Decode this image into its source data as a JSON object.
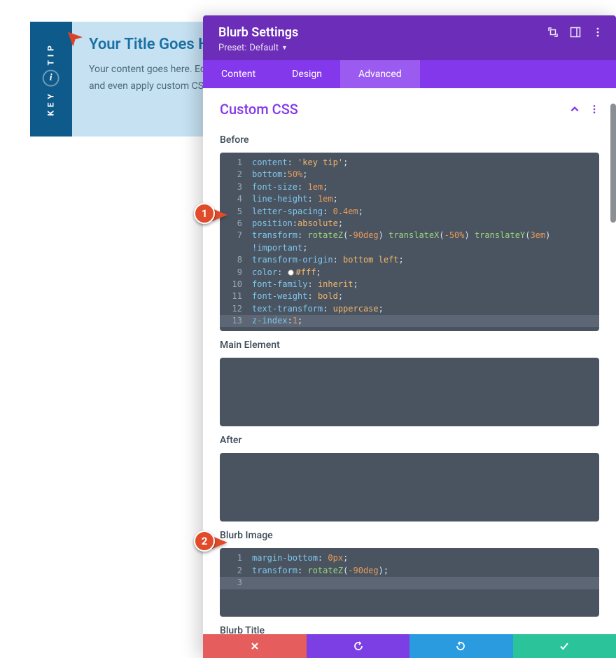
{
  "preview": {
    "side_label": "KEY TIP",
    "title": "Your Title Goes H",
    "body": "Your content goes here. Edit settings. You can also style e and even apply custom CSS t"
  },
  "panel": {
    "title": "Blurb Settings",
    "preset_prefix": "Preset: ",
    "preset_value": "Default"
  },
  "tabs": [
    {
      "id": "content",
      "label": "Content",
      "active": false
    },
    {
      "id": "design",
      "label": "Design",
      "active": false
    },
    {
      "id": "advanced",
      "label": "Advanced",
      "active": true
    }
  ],
  "section": {
    "title": "Custom CSS"
  },
  "fields": {
    "before": {
      "label": "Before"
    },
    "main_element": {
      "label": "Main Element"
    },
    "after": {
      "label": "After"
    },
    "blurb_image": {
      "label": "Blurb Image"
    },
    "blurb_title": {
      "label": "Blurb Title"
    }
  },
  "code": {
    "before": [
      {
        "n": 1,
        "parts": [
          [
            "prop",
            "content"
          ],
          [
            "punc",
            ": "
          ],
          [
            "str",
            "'key tip'"
          ],
          [
            "punc",
            ";"
          ]
        ]
      },
      {
        "n": 2,
        "parts": [
          [
            "prop",
            "bottom"
          ],
          [
            "punc",
            ":"
          ],
          [
            "num",
            "50%"
          ],
          [
            "punc",
            ";"
          ]
        ]
      },
      {
        "n": 3,
        "parts": [
          [
            "prop",
            "font-size"
          ],
          [
            "punc",
            ": "
          ],
          [
            "num",
            "1em"
          ],
          [
            "punc",
            ";"
          ]
        ]
      },
      {
        "n": 4,
        "parts": [
          [
            "prop",
            "line-height"
          ],
          [
            "punc",
            ": "
          ],
          [
            "num",
            "1em"
          ],
          [
            "punc",
            ";"
          ]
        ]
      },
      {
        "n": 5,
        "parts": [
          [
            "prop",
            "letter-spacing"
          ],
          [
            "punc",
            ": "
          ],
          [
            "num",
            "0.4em"
          ],
          [
            "punc",
            ";"
          ]
        ]
      },
      {
        "n": 6,
        "parts": [
          [
            "prop",
            "position"
          ],
          [
            "punc",
            ":"
          ],
          [
            "kw",
            "absolute"
          ],
          [
            "punc",
            ";"
          ]
        ]
      },
      {
        "n": 7,
        "parts": [
          [
            "prop",
            "transform"
          ],
          [
            "punc",
            ": "
          ],
          [
            "fn",
            "rotateZ"
          ],
          [
            "punc",
            "("
          ],
          [
            "num",
            "-90deg"
          ],
          [
            "punc",
            ") "
          ],
          [
            "fn",
            "translateX"
          ],
          [
            "punc",
            "("
          ],
          [
            "num",
            "-50%"
          ],
          [
            "punc",
            ") "
          ],
          [
            "fn",
            "translateY"
          ],
          [
            "punc",
            "("
          ],
          [
            "num",
            "3em"
          ],
          [
            "punc",
            ") "
          ],
          [
            "imp",
            "!important"
          ],
          [
            "punc",
            ";"
          ]
        ]
      },
      {
        "n": 8,
        "parts": [
          [
            "prop",
            "transform-origin"
          ],
          [
            "punc",
            ": "
          ],
          [
            "kw",
            "bottom left"
          ],
          [
            "punc",
            ";"
          ]
        ]
      },
      {
        "n": 9,
        "parts": [
          [
            "prop",
            "color"
          ],
          [
            "punc",
            ": "
          ],
          [
            "colordot",
            ""
          ],
          [
            "str",
            "#fff"
          ],
          [
            "punc",
            ";"
          ]
        ]
      },
      {
        "n": 10,
        "parts": [
          [
            "prop",
            "font-family"
          ],
          [
            "punc",
            ": "
          ],
          [
            "kw",
            "inherit"
          ],
          [
            "punc",
            ";"
          ]
        ]
      },
      {
        "n": 11,
        "parts": [
          [
            "prop",
            "font-weight"
          ],
          [
            "punc",
            ": "
          ],
          [
            "kw",
            "bold"
          ],
          [
            "punc",
            ";"
          ]
        ]
      },
      {
        "n": 12,
        "parts": [
          [
            "prop",
            "text-transform"
          ],
          [
            "punc",
            ": "
          ],
          [
            "kw",
            "uppercase"
          ],
          [
            "punc",
            ";"
          ]
        ]
      },
      {
        "n": 13,
        "active": true,
        "parts": [
          [
            "prop",
            "z-index"
          ],
          [
            "punc",
            ":"
          ],
          [
            "num",
            "1"
          ],
          [
            "punc",
            ";"
          ]
        ]
      }
    ],
    "blurb_image": [
      {
        "n": 1,
        "parts": [
          [
            "prop",
            "margin-bottom"
          ],
          [
            "punc",
            ": "
          ],
          [
            "num",
            "0px"
          ],
          [
            "punc",
            ";"
          ]
        ]
      },
      {
        "n": 2,
        "parts": [
          [
            "prop",
            "transform"
          ],
          [
            "punc",
            ": "
          ],
          [
            "fn",
            "rotateZ"
          ],
          [
            "punc",
            "("
          ],
          [
            "num",
            "-90deg"
          ],
          [
            "punc",
            ");"
          ]
        ]
      },
      {
        "n": 3,
        "active": true,
        "parts": []
      }
    ]
  },
  "callouts": {
    "one": "1",
    "two": "2"
  },
  "colors": {
    "header": "#6c2eb9",
    "tabs": "#8338ec",
    "accent": "#8338ec",
    "cancel": "#e55d5d",
    "undo": "#7b3fe4",
    "redo": "#2b9be0",
    "save": "#2bc49a"
  }
}
